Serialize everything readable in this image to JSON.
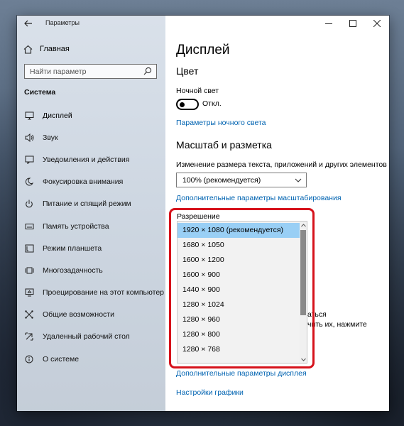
{
  "window": {
    "title": "Параметры"
  },
  "sidebar": {
    "home_label": "Главная",
    "search_placeholder": "Найти параметр",
    "section_title": "Система",
    "items": [
      {
        "label": "Дисплей",
        "icon": "monitor-icon"
      },
      {
        "label": "Звук",
        "icon": "speaker-icon"
      },
      {
        "label": "Уведомления и действия",
        "icon": "notifications-icon"
      },
      {
        "label": "Фокусировка внимания",
        "icon": "moon-icon"
      },
      {
        "label": "Питание и спящий режим",
        "icon": "power-icon"
      },
      {
        "label": "Память устройства",
        "icon": "storage-icon"
      },
      {
        "label": "Режим планшета",
        "icon": "tablet-icon"
      },
      {
        "label": "Многозадачность",
        "icon": "multitasking-icon"
      },
      {
        "label": "Проецирование на этот компьютер",
        "icon": "projecting-icon"
      },
      {
        "label": "Общие возможности",
        "icon": "shared-experiences-icon"
      },
      {
        "label": "Удаленный рабочий стол",
        "icon": "remote-desktop-icon"
      },
      {
        "label": "О системе",
        "icon": "info-icon"
      }
    ],
    "active_item": "Дисплей"
  },
  "content": {
    "page_title": "Дисплей",
    "color_heading": "Цвет",
    "night_light_label": "Ночной свет",
    "night_light_state": "Откл.",
    "night_light_link": "Параметры ночного света",
    "scale_heading": "Масштаб и разметка",
    "scale_label": "Изменение размера текста, приложений и других элементов",
    "scale_value": "100% (рекомендуется)",
    "advanced_scale_link": "Дополнительные параметры масштабирования",
    "resolution_label": "Разрешение",
    "resolution_options": [
      "1920 × 1080 (рекомендуется)",
      "1680 × 1050",
      "1600 × 1200",
      "1600 × 900",
      "1440 × 900",
      "1280 × 1024",
      "1280 × 960",
      "1280 × 800",
      "1280 × 768"
    ],
    "resolution_selected": "1920 × 1080 (рекомендуется)",
    "partial_text_1": "аться",
    "partial_text_2": "чить их, нажмите",
    "advanced_display_link": "Дополнительные параметры дисплея",
    "graphics_link": "Настройки графики"
  },
  "colors": {
    "accent_link": "#0063b1",
    "selection": "#99cff5",
    "highlight_border": "#d6121b"
  }
}
